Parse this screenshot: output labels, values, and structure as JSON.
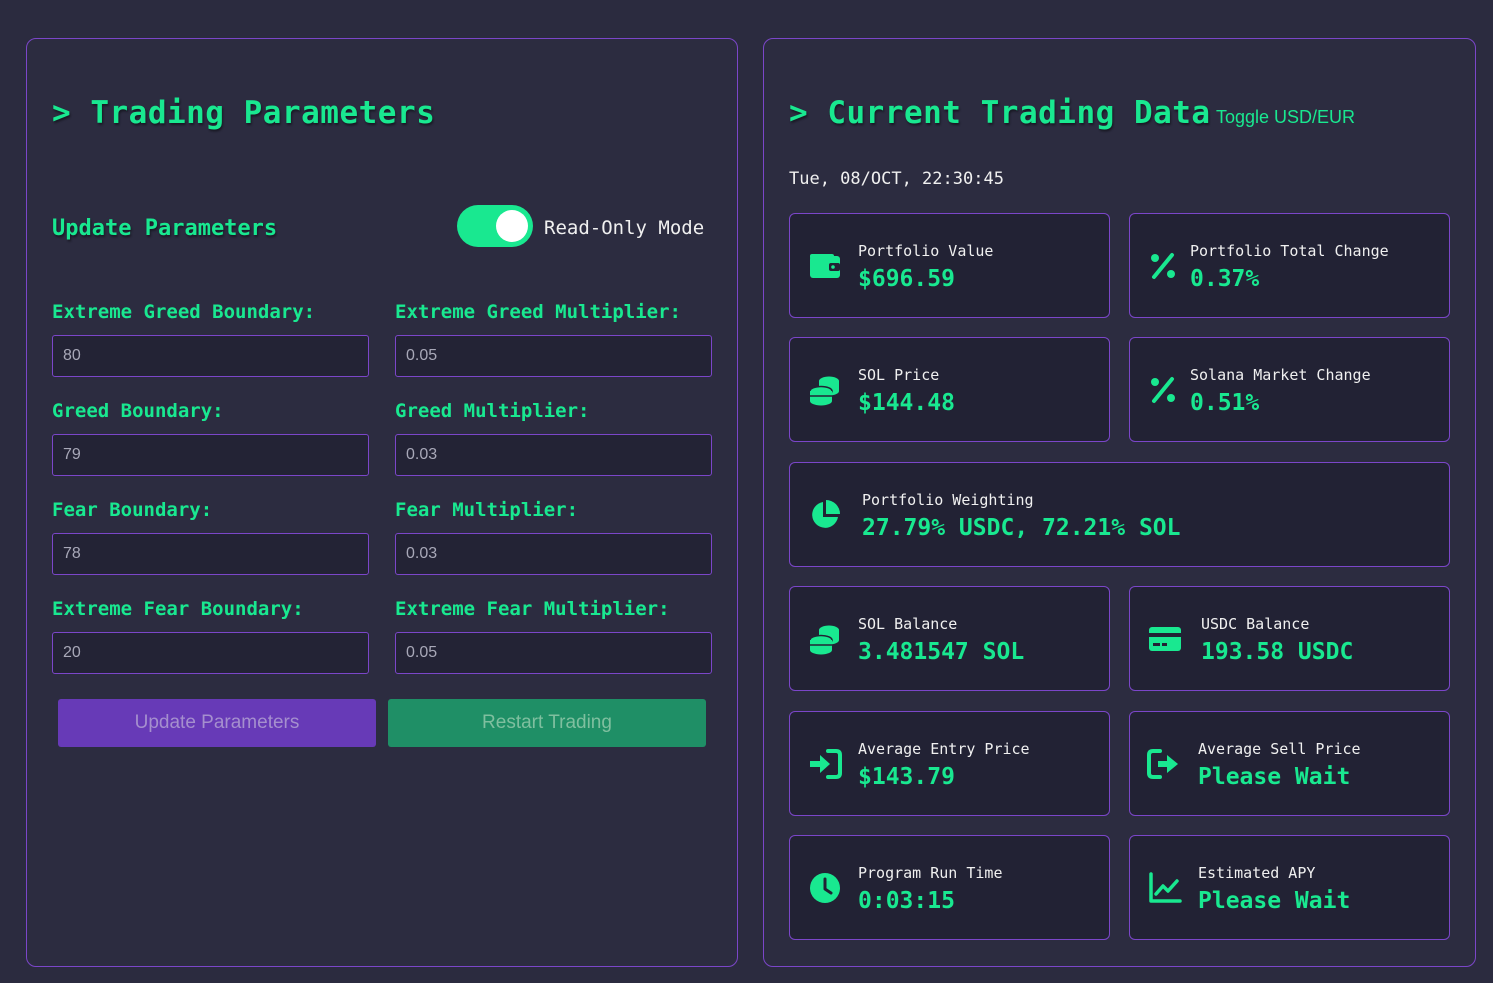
{
  "left": {
    "title": "> Trading Parameters",
    "subtitle": "Update Parameters",
    "toggle_label": "Read-Only Mode",
    "toggle_on": true,
    "fields": [
      {
        "label": "Extreme Greed Boundary:",
        "value": "80"
      },
      {
        "label": "Extreme Greed Multiplier:",
        "value": "0.05"
      },
      {
        "label": "Greed Boundary:",
        "value": "79"
      },
      {
        "label": "Greed Multiplier:",
        "value": "0.03"
      },
      {
        "label": "Fear Boundary:",
        "value": "78"
      },
      {
        "label": "Fear Multiplier:",
        "value": "0.03"
      },
      {
        "label": "Extreme Fear Boundary:",
        "value": "20"
      },
      {
        "label": "Extreme Fear Multiplier:",
        "value": "0.05"
      }
    ],
    "update_button": "Update Parameters",
    "restart_button": "Restart Trading"
  },
  "right": {
    "title": "> Current Trading Data",
    "toggle_currency": "Toggle USD/EUR",
    "datetime": "Tue, 08/OCT, 22:30:45",
    "cards": [
      {
        "label": "Portfolio Value",
        "value": "$696.59",
        "icon": "wallet-icon"
      },
      {
        "label": "Portfolio Total Change",
        "value": "0.37%",
        "icon": "percent-icon"
      },
      {
        "label": "SOL Price",
        "value": "$144.48",
        "icon": "coins-icon"
      },
      {
        "label": "Solana Market Change",
        "value": "0.51%",
        "icon": "percent-icon"
      },
      {
        "label": "Portfolio Weighting",
        "value": "27.79% USDC, 72.21% SOL",
        "icon": "pie-chart-icon"
      },
      {
        "label": "SOL Balance",
        "value": "3.481547 SOL",
        "icon": "coins-icon"
      },
      {
        "label": "USDC Balance",
        "value": "193.58 USDC",
        "icon": "credit-card-icon"
      },
      {
        "label": "Average Entry Price",
        "value": "$143.79",
        "icon": "sign-in-icon"
      },
      {
        "label": "Average Sell Price",
        "value": "Please Wait",
        "icon": "sign-out-icon"
      },
      {
        "label": "Program Run Time",
        "value": "0:03:15",
        "icon": "clock-icon"
      },
      {
        "label": "Estimated APY",
        "value": "Please Wait",
        "icon": "line-chart-icon"
      }
    ]
  },
  "colors": {
    "background": "#2b2b3f",
    "accent": "#19e890",
    "border": "#7b46c9",
    "card_bg": "#222234",
    "update_button": "#673ab7",
    "restart_button": "#1f8f66"
  }
}
